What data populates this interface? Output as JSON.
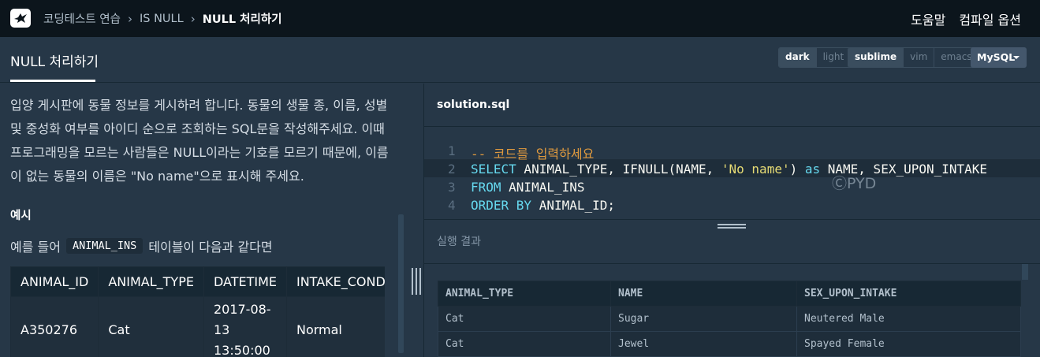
{
  "breadcrumb": {
    "items": [
      "코딩테스트 연습",
      "IS NULL",
      "NULL 처리하기"
    ]
  },
  "header_links": {
    "help": "도움말",
    "compile_options": "컴파일 옵션"
  },
  "page_title": "NULL 처리하기",
  "theme_toggle": {
    "options": [
      "dark",
      "light"
    ],
    "selected": "dark"
  },
  "keymap_toggle": {
    "options": [
      "sublime",
      "vim",
      "emacs"
    ],
    "selected": "sublime"
  },
  "language_select": {
    "value": "MySQL"
  },
  "problem": {
    "description": "입양 게시판에 동물 정보를 게시하려 합니다. 동물의 생물 종, 이름, 성별 및 중성화 여부를 아이디 순으로 조회하는 SQL문을 작성해주세요. 이때 프로그래밍을 모르는 사람들은 NULL이라는 기호를 모르기 때문에, 이름이 없는 동물의 이름은 \"No name\"으로 표시해 주세요.",
    "example_heading": "예시",
    "example_text_before": "예를 들어",
    "example_table_name": "ANIMAL_INS",
    "example_text_after": "테이블이 다음과 같다면",
    "sample_table": {
      "headers": [
        "ANIMAL_ID",
        "ANIMAL_TYPE",
        "DATETIME",
        "INTAKE_CONDITION"
      ],
      "rows": [
        [
          "A350276",
          "Cat",
          "2017-08-13 13:50:00",
          "Normal"
        ]
      ]
    }
  },
  "editor": {
    "filename": "solution.sql",
    "line_numbers": [
      "1",
      "2",
      "3",
      "4"
    ],
    "line1": "-- 코드를 입력하세요",
    "line2": {
      "k1": "SELECT",
      "t1": " ANIMAL_TYPE, IFNULL(NAME, ",
      "s1": "'No name'",
      "t2": ") ",
      "k2": "as",
      "t3": " NAME, SEX_UPON_INTAKE"
    },
    "line3": {
      "k1": "FROM",
      "t1": " ANIMAL_INS"
    },
    "line4": {
      "k1": "ORDER BY",
      "t1": " ANIMAL_ID;"
    },
    "watermark": "ⒸPYD"
  },
  "result": {
    "label": "실행 결과",
    "headers": [
      "ANIMAL_TYPE",
      "NAME",
      "SEX_UPON_INTAKE"
    ],
    "rows": [
      [
        "Cat",
        "Sugar",
        "Neutered Male"
      ],
      [
        "Cat",
        "Jewel",
        "Spayed Female"
      ]
    ]
  }
}
